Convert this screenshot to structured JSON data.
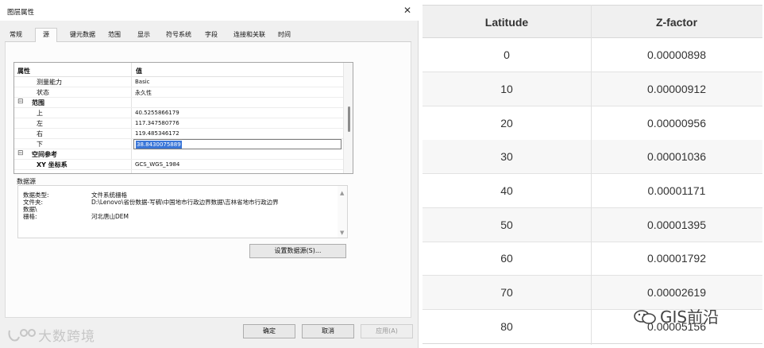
{
  "dialog": {
    "title": "图层属性",
    "close_glyph": "✕",
    "tabs": [
      "常规",
      "源",
      "键元数据",
      "范围",
      "显示",
      "符号系统",
      "字段",
      "连接和关联",
      "时间"
    ],
    "active_tab": "源",
    "grid": {
      "col_property": "属性",
      "col_value": "值",
      "rows": [
        {
          "key": "测量能力",
          "value": "Basic"
        },
        {
          "key": "状态",
          "value": "永久性"
        },
        {
          "key": "范围",
          "value": "",
          "expander": "⊟",
          "category": true
        },
        {
          "key": "上",
          "value": "40.5255866179"
        },
        {
          "key": "左",
          "value": "117.347580776"
        },
        {
          "key": "右",
          "value": "119.485346172"
        },
        {
          "key": "下",
          "value": "38.8430075889",
          "editing": true
        },
        {
          "key": "空间参考",
          "value": "",
          "expander": "⊟",
          "category": true
        },
        {
          "key": "XY 坐标系",
          "value": "GCS_WGS_1984",
          "bold": true
        }
      ]
    },
    "datasource": {
      "label": "数据源",
      "rows": [
        {
          "key": "数据类型:",
          "value": "文件系统栅格"
        },
        {
          "key": "文件夹:",
          "value": "D:\\Lenovo\\省份数据-写稿\\中国地市行政边界数据\\吉林省地市行政边界"
        },
        {
          "key": "数据\\",
          "value": ""
        },
        {
          "key": "栅格:",
          "value": "河北唐山DEM"
        }
      ],
      "set_button": "设置数据源(S)..."
    },
    "buttons": {
      "ok": "确定",
      "cancel": "取消",
      "apply": "应用(A)"
    },
    "watermark": "大数跨境"
  },
  "table": {
    "headers": [
      "Latitude",
      "Z-factor"
    ],
    "rows": [
      [
        "0",
        "0.00000898"
      ],
      [
        "10",
        "0.00000912"
      ],
      [
        "20",
        "0.00000956"
      ],
      [
        "30",
        "0.00001036"
      ],
      [
        "40",
        "0.00001171"
      ],
      [
        "50",
        "0.00001395"
      ],
      [
        "60",
        "0.00001792"
      ],
      [
        "70",
        "0.00002619"
      ],
      [
        "80",
        "0.00005156"
      ]
    ],
    "watermark": "GIS前沿"
  }
}
